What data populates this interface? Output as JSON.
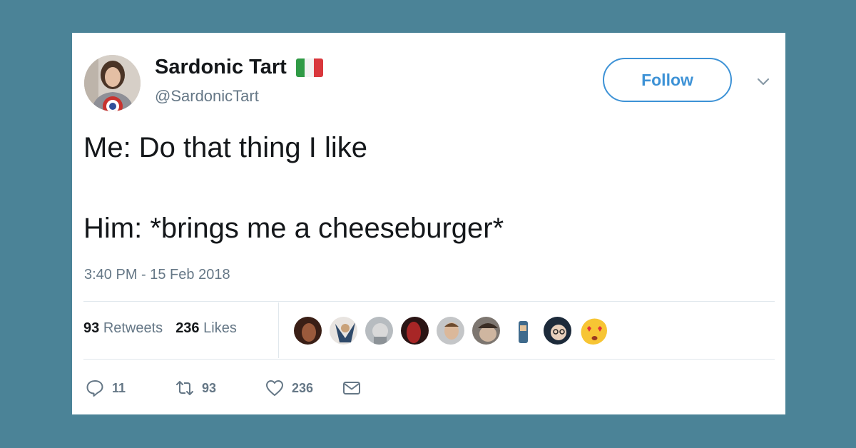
{
  "tweet": {
    "display_name": "Sardonic Tart",
    "handle": "@SardonicTart",
    "follow_label": "Follow",
    "text_line1": "Me: Do that thing I like",
    "text_line2": "Him: *brings me a cheeseburger*",
    "timestamp": "3:40 PM - 15 Feb 2018",
    "flag": "italy-flag"
  },
  "stats": {
    "retweets_count": "93",
    "retweets_label": "Retweets",
    "likes_count": "236",
    "likes_label": "Likes"
  },
  "likers_count": 9,
  "actions": {
    "replies": "11",
    "retweets": "93",
    "likes": "236"
  },
  "colors": {
    "background": "#4b8397",
    "accent": "#3d92d6",
    "muted": "#657786",
    "text": "#14171a"
  },
  "icons": [
    "reply-icon",
    "retweet-icon",
    "heart-icon",
    "mail-icon",
    "chevron-down-icon"
  ]
}
